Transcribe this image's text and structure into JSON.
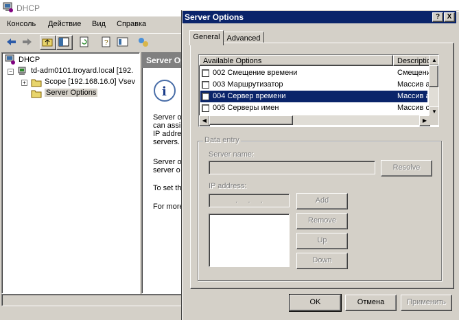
{
  "main_window": {
    "title": "DHCP",
    "menu": [
      "Консоль",
      "Действие",
      "Вид",
      "Справка"
    ],
    "tree": {
      "root": "DHCP",
      "server": "td-adm0101.troyard.local [192.",
      "scope": "Scope [192.168.16.0] Vsev",
      "server_options": "Server Options"
    },
    "detail": {
      "header": "Server Op",
      "para1": [
        "Server o",
        "can assi",
        "IP addre",
        "servers."
      ],
      "para2": [
        "Server o",
        "server o"
      ],
      "para3": "To set th",
      "para4": "For more"
    }
  },
  "dialog": {
    "title": "Server Options",
    "help_btn": "?",
    "close_btn": "X",
    "tabs": [
      "General",
      "Advanced"
    ],
    "active_tab": "General",
    "columns": [
      "Available Options",
      "Descriptio"
    ],
    "options": [
      {
        "name": "002 Смещение времени",
        "desc": "Смещени",
        "checked": false,
        "selected": false
      },
      {
        "name": "003 Маршрутизатор",
        "desc": "Массив а",
        "checked": false,
        "selected": false
      },
      {
        "name": "004 Сервер времени",
        "desc": "Массив а",
        "checked": false,
        "selected": true
      },
      {
        "name": "005 Серверы имен",
        "desc": "Массив с",
        "checked": false,
        "selected": false
      }
    ],
    "data_entry": {
      "legend": "Data entry",
      "server_name_label": "Server name:",
      "server_name_value": "",
      "resolve": "Resolve",
      "ip_label": "IP address:",
      "ip_dots": ".     .     .",
      "add": "Add",
      "remove": "Remove",
      "up": "Up",
      "down": "Down"
    },
    "buttons": {
      "ok": "OK",
      "cancel": "Отмена",
      "apply": "Применить"
    }
  },
  "colors": {
    "title_active": "#0a246a",
    "face": "#d4d0c8",
    "selection": "#0a246a"
  }
}
